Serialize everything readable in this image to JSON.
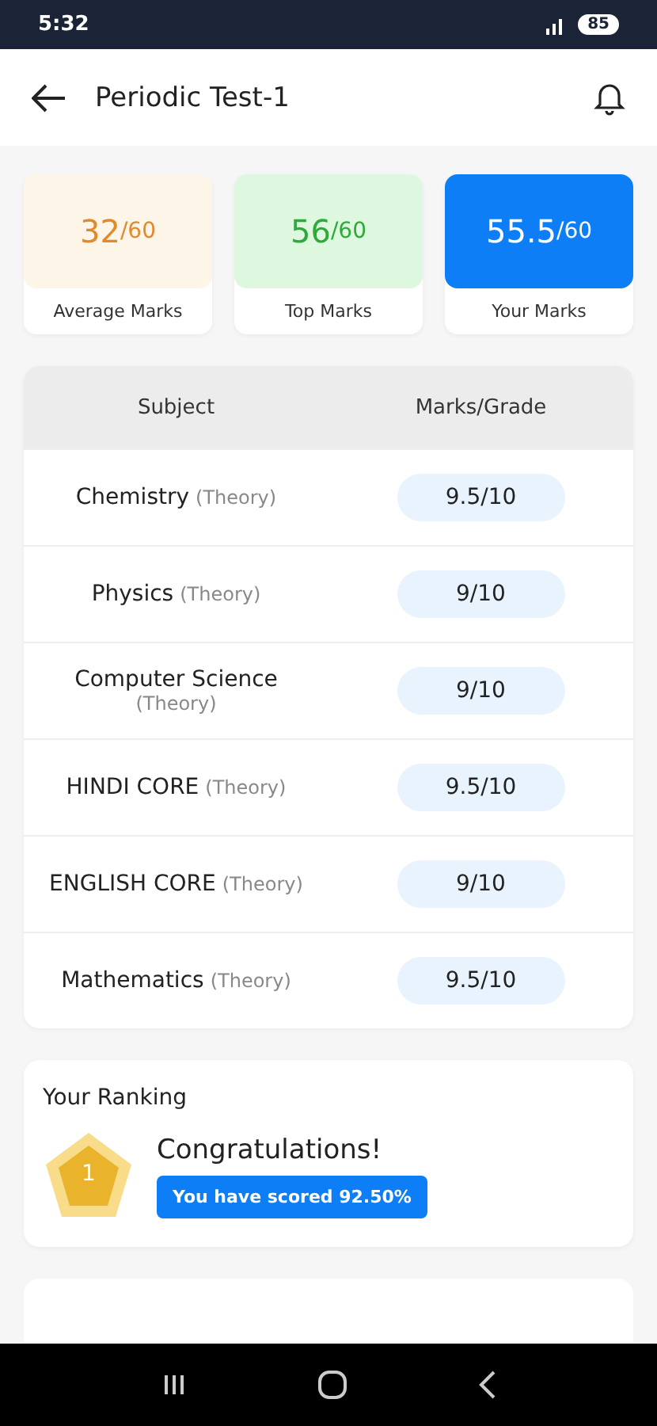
{
  "status_bar": {
    "time": "5:32",
    "battery": "85"
  },
  "header": {
    "title": "Periodic Test-1"
  },
  "stats": [
    {
      "kind": "average",
      "value": "32",
      "total": "/60",
      "label": "Average Marks"
    },
    {
      "kind": "top",
      "value": "56",
      "total": "/60",
      "label": "Top Marks"
    },
    {
      "kind": "yours",
      "value": "55.5",
      "total": "/60",
      "label": "Your Marks"
    }
  ],
  "table": {
    "columns": [
      "Subject",
      "Marks/Grade"
    ],
    "rows": [
      {
        "subject": "Chemistry",
        "type": "(Theory)",
        "marks": "9.5/10"
      },
      {
        "subject": "Physics",
        "type": "(Theory)",
        "marks": "9/10"
      },
      {
        "subject": "Computer Science",
        "type": "(Theory)",
        "marks": "9/10"
      },
      {
        "subject": "HINDI CORE",
        "type": "(Theory)",
        "marks": "9.5/10"
      },
      {
        "subject": "ENGLISH CORE",
        "type": "(Theory)",
        "marks": "9/10"
      },
      {
        "subject": "Mathematics",
        "type": "(Theory)",
        "marks": "9.5/10"
      }
    ]
  },
  "ranking": {
    "title": "Your Ranking",
    "rank": "1",
    "heading": "Congratulations!",
    "score": "You have scored 92.50%"
  }
}
